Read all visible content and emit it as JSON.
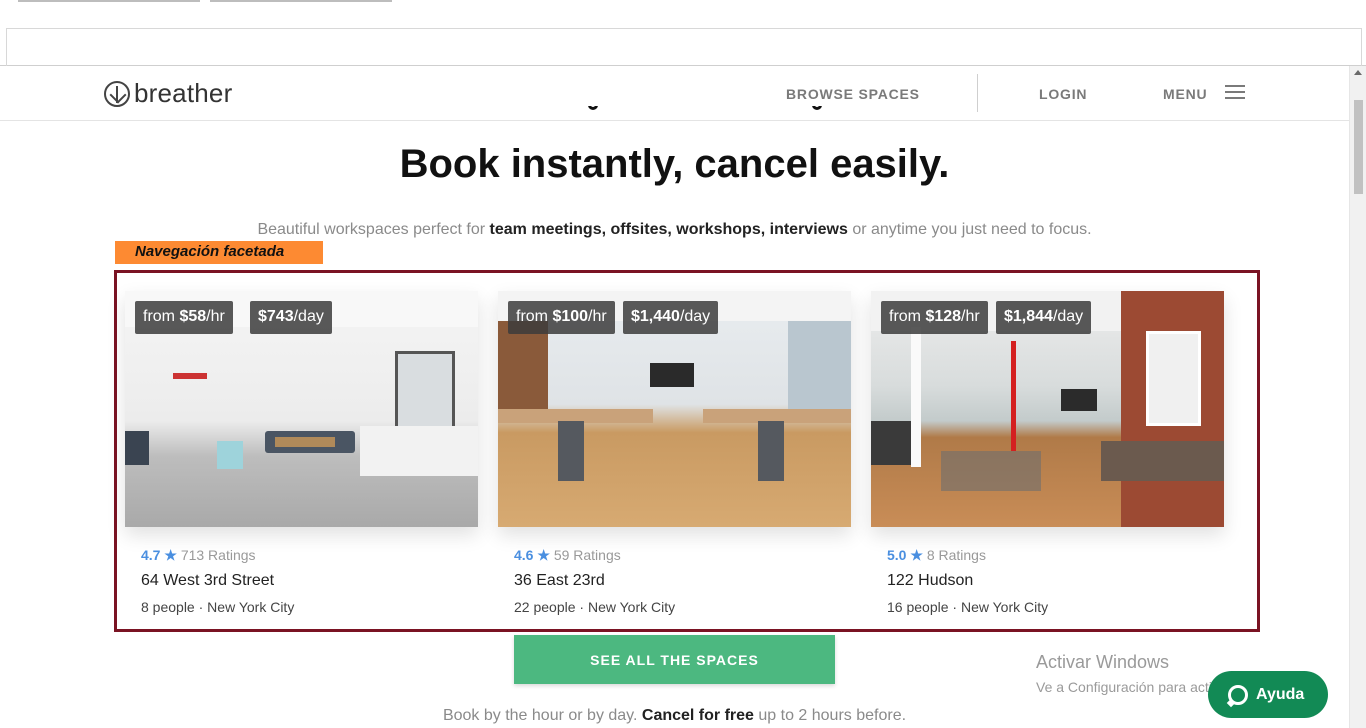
{
  "header": {
    "logo_text": "breather",
    "nav": {
      "browse_spaces": "BROWSE SPACES",
      "login": "LOGIN",
      "menu": "MENU"
    }
  },
  "hero": {
    "title": "Book instantly, cancel easily.",
    "subtitle_pre": "Beautiful workspaces perfect for ",
    "subtitle_bold": "team meetings, offsites, workshops, interviews",
    "subtitle_post": " or anytime you just need to focus."
  },
  "annotation": {
    "facet_label": "Navegación facetada",
    "highlight_color": "#7a1323",
    "label_color": "#fd8a32"
  },
  "spaces": [
    {
      "hourly_prefix": "from ",
      "hourly_amount": "$58",
      "hourly_unit": "/hr",
      "daily_amount": "$743",
      "daily_unit": "/day",
      "rating_score": "4.7",
      "rating_star": "★",
      "rating_count": "713 Ratings",
      "address": "64 West 3rd Street",
      "capacity": "8 people",
      "separator": " · ",
      "city": "New York City"
    },
    {
      "hourly_prefix": "from ",
      "hourly_amount": "$100",
      "hourly_unit": "/hr",
      "daily_amount": "$1,440",
      "daily_unit": "/day",
      "rating_score": "4.6",
      "rating_star": "★",
      "rating_count": "59 Ratings",
      "address": "36 East 23rd",
      "capacity": "22 people",
      "separator": " · ",
      "city": "New York City"
    },
    {
      "hourly_prefix": "from ",
      "hourly_amount": "$128",
      "hourly_unit": "/hr",
      "daily_amount": "$1,844",
      "daily_unit": "/day",
      "rating_score": "5.0",
      "rating_star": "★",
      "rating_count": "8 Ratings",
      "address": "122 Hudson",
      "capacity": "16 people",
      "separator": " · ",
      "city": "New York City"
    }
  ],
  "cta": {
    "label": "SEE ALL THE SPACES",
    "color": "#4cb880"
  },
  "footer_note": {
    "pre": "Book by the hour or by day. ",
    "bold": "Cancel for free",
    "post": " up to 2 hours before."
  },
  "windows_watermark": {
    "line1": "Activar Windows",
    "line2": "Ve a Configuración para activar Windows."
  },
  "help": {
    "label": "Ayuda",
    "color": "#128a55"
  },
  "accent_colors": {
    "rating_blue": "#4a8fe0"
  }
}
